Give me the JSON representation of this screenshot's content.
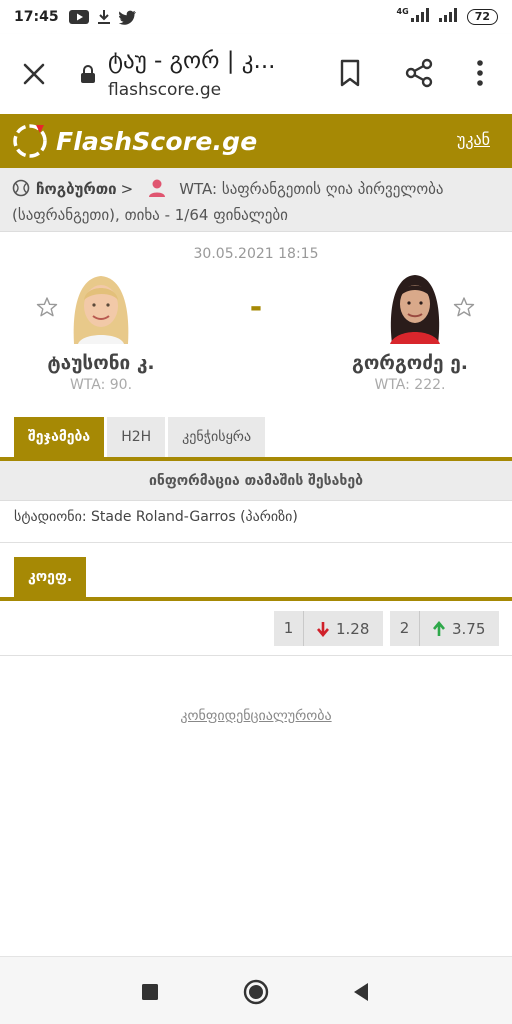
{
  "status_bar": {
    "time": "17:45",
    "network": "4G",
    "battery": "72",
    "icons": [
      "youtube-icon",
      "download-icon",
      "twitter-icon",
      "signal-icon",
      "signal-icon",
      "battery-icon"
    ]
  },
  "browser": {
    "title": "ტაუ - გორ | კ...",
    "url": "flashscore.ge",
    "icons": [
      "close-icon",
      "lock-icon",
      "bookmark-icon",
      "share-icon",
      "more-icon"
    ]
  },
  "site": {
    "brand": "FlashScore.ge",
    "back_label": "უკან",
    "accent": "#a68905"
  },
  "breadcrumb": {
    "sport_country": "ჩოგბურთი",
    "separator": ">",
    "competition_line1": "WTA: საფრანგეთის ღია პირველობა",
    "competition_line2": "(საფრანგეთი), თიხა - 1/64 ფინალები"
  },
  "match": {
    "datetime": "30.05.2021 18:15",
    "score": "-",
    "home": {
      "name": "ტაუსონი კ.",
      "rank": "WTA: 90."
    },
    "away": {
      "name": "გორგოძე ე.",
      "rank": "WTA: 222."
    }
  },
  "tabs": [
    {
      "label": "შეჯამება",
      "active": true
    },
    {
      "label": "H2H",
      "active": false
    },
    {
      "label": "კენჭისყრა",
      "active": false
    }
  ],
  "info": {
    "section_title": "ინფორმაცია თამაშის შესახებ",
    "stadium": "სტადიონი: Stade Roland-Garros (პარიზი)"
  },
  "odds": {
    "tab_label": "კოეფ.",
    "items": [
      {
        "index": "1",
        "value": "1.28",
        "direction": "down",
        "color": "#d0202a"
      },
      {
        "index": "2",
        "value": "3.75",
        "direction": "up",
        "color": "#2ea84a"
      }
    ]
  },
  "footer": {
    "privacy_label": "კონფიდენციალურობა"
  },
  "nav": {
    "icons": [
      "recent-apps-icon",
      "home-icon",
      "back-icon"
    ]
  }
}
